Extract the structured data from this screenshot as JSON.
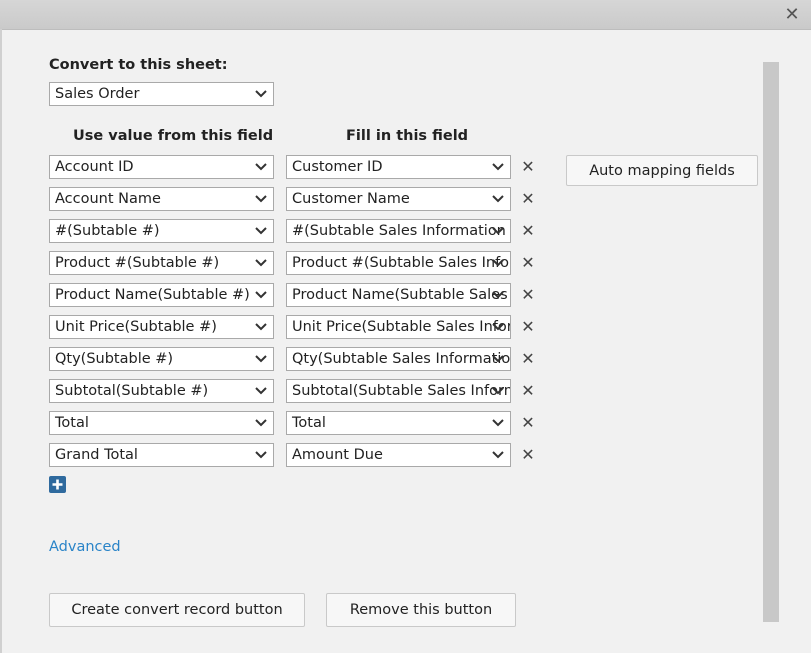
{
  "dialog": {
    "close_glyph": "✕"
  },
  "target": {
    "label": "Convert to this sheet:",
    "selected": "Sales Order"
  },
  "columns": {
    "source_header": "Use value from this field",
    "dest_header": "Fill in this field"
  },
  "mappings": [
    {
      "source": "Account ID",
      "dest": "Customer ID"
    },
    {
      "source": "Account Name",
      "dest": "Customer Name"
    },
    {
      "source": "#(Subtable #)",
      "dest": "#(Subtable Sales Information #)"
    },
    {
      "source": "Product #(Subtable #)",
      "dest": "Product #(Subtable Sales Information #)"
    },
    {
      "source": "Product Name(Subtable #)",
      "dest": "Product Name(Subtable Sales Information #)"
    },
    {
      "source": "Unit Price(Subtable #)",
      "dest": "Unit Price(Subtable Sales Information #)"
    },
    {
      "source": "Qty(Subtable #)",
      "dest": "Qty(Subtable Sales Information #)"
    },
    {
      "source": "Subtotal(Subtable #)",
      "dest": "Subtotal(Subtable Sales Information #)"
    },
    {
      "source": "Total",
      "dest": "Total"
    },
    {
      "source": "Grand Total",
      "dest": "Amount Due"
    }
  ],
  "delete_glyph": "✕",
  "auto_mapping_label": "Auto mapping fields",
  "advanced_label": "Advanced",
  "footer": {
    "create_label": "Create convert record button",
    "remove_label": "Remove this button"
  },
  "icons": {
    "close": "close-icon",
    "chevron": "chevron-down-icon",
    "delete": "delete-icon",
    "add": "plus-icon"
  },
  "colors": {
    "accent": "#2f6a9e",
    "link": "#2a84c8",
    "background": "#f1f1f1"
  }
}
